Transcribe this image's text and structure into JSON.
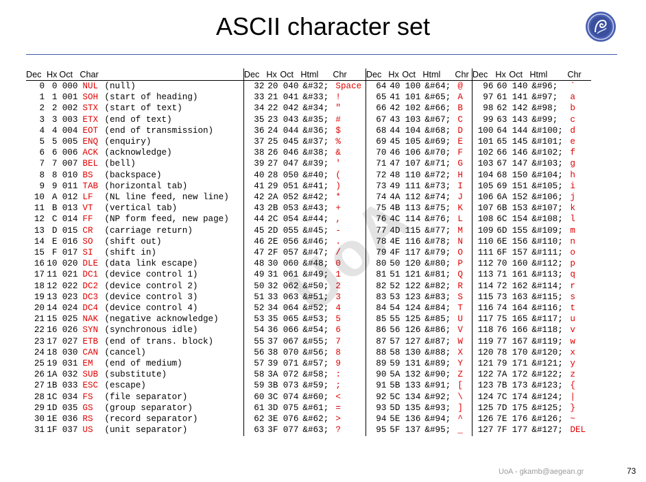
{
  "title": "ASCII character set",
  "watermark": "UoA",
  "footer": "UoA - gkamb@aegean.gr",
  "page_number": "73",
  "colors": {
    "code_red": "#e00000",
    "rule_blue": "#3d55a8"
  },
  "logo_icon": "university-seal-icon",
  "headers": {
    "g1": [
      "Dec",
      "Hx",
      "Oct",
      "Char",
      ""
    ],
    "g2": [
      "Dec",
      "Hx",
      "Oct",
      "Html",
      "Chr"
    ],
    "g3": [
      "Dec",
      "Hx",
      "Oct",
      "Html",
      "Chr"
    ],
    "g4": [
      "Dec",
      "Hx",
      "Oct",
      "Html",
      "Chr"
    ]
  },
  "rows": [
    {
      "g1": [
        "0",
        "0",
        "000",
        "NUL",
        "(null)"
      ],
      "g2": [
        "32",
        "20",
        "040",
        "&#32;",
        "Space"
      ],
      "g3": [
        "64",
        "40",
        "100",
        "&#64;",
        "@"
      ],
      "g4": [
        "96",
        "60",
        "140",
        "&#96;",
        "`"
      ]
    },
    {
      "g1": [
        "1",
        "1",
        "001",
        "SOH",
        "(start of heading)"
      ],
      "g2": [
        "33",
        "21",
        "041",
        "&#33;",
        "!"
      ],
      "g3": [
        "65",
        "41",
        "101",
        "&#65;",
        "A"
      ],
      "g4": [
        "97",
        "61",
        "141",
        "&#97;",
        "a"
      ]
    },
    {
      "g1": [
        "2",
        "2",
        "002",
        "STX",
        "(start of text)"
      ],
      "g2": [
        "34",
        "22",
        "042",
        "&#34;",
        "\""
      ],
      "g3": [
        "66",
        "42",
        "102",
        "&#66;",
        "B"
      ],
      "g4": [
        "98",
        "62",
        "142",
        "&#98;",
        "b"
      ]
    },
    {
      "g1": [
        "3",
        "3",
        "003",
        "ETX",
        "(end of text)"
      ],
      "g2": [
        "35",
        "23",
        "043",
        "&#35;",
        "#"
      ],
      "g3": [
        "67",
        "43",
        "103",
        "&#67;",
        "C"
      ],
      "g4": [
        "99",
        "63",
        "143",
        "&#99;",
        "c"
      ]
    },
    {
      "g1": [
        "4",
        "4",
        "004",
        "EOT",
        "(end of transmission)"
      ],
      "g2": [
        "36",
        "24",
        "044",
        "&#36;",
        "$"
      ],
      "g3": [
        "68",
        "44",
        "104",
        "&#68;",
        "D"
      ],
      "g4": [
        "100",
        "64",
        "144",
        "&#100;",
        "d"
      ]
    },
    {
      "g1": [
        "5",
        "5",
        "005",
        "ENQ",
        "(enquiry)"
      ],
      "g2": [
        "37",
        "25",
        "045",
        "&#37;",
        "%"
      ],
      "g3": [
        "69",
        "45",
        "105",
        "&#69;",
        "E"
      ],
      "g4": [
        "101",
        "65",
        "145",
        "&#101;",
        "e"
      ]
    },
    {
      "g1": [
        "6",
        "6",
        "006",
        "ACK",
        "(acknowledge)"
      ],
      "g2": [
        "38",
        "26",
        "046",
        "&#38;",
        "&"
      ],
      "g3": [
        "70",
        "46",
        "106",
        "&#70;",
        "F"
      ],
      "g4": [
        "102",
        "66",
        "146",
        "&#102;",
        "f"
      ]
    },
    {
      "g1": [
        "7",
        "7",
        "007",
        "BEL",
        "(bell)"
      ],
      "g2": [
        "39",
        "27",
        "047",
        "&#39;",
        "'"
      ],
      "g3": [
        "71",
        "47",
        "107",
        "&#71;",
        "G"
      ],
      "g4": [
        "103",
        "67",
        "147",
        "&#103;",
        "g"
      ]
    },
    {
      "g1": [
        "8",
        "8",
        "010",
        "BS",
        "(backspace)"
      ],
      "g2": [
        "40",
        "28",
        "050",
        "&#40;",
        "("
      ],
      "g3": [
        "72",
        "48",
        "110",
        "&#72;",
        "H"
      ],
      "g4": [
        "104",
        "68",
        "150",
        "&#104;",
        "h"
      ]
    },
    {
      "g1": [
        "9",
        "9",
        "011",
        "TAB",
        "(horizontal tab)"
      ],
      "g2": [
        "41",
        "29",
        "051",
        "&#41;",
        ")"
      ],
      "g3": [
        "73",
        "49",
        "111",
        "&#73;",
        "I"
      ],
      "g4": [
        "105",
        "69",
        "151",
        "&#105;",
        "i"
      ]
    },
    {
      "g1": [
        "10",
        "A",
        "012",
        "LF",
        "(NL line feed, new line)"
      ],
      "g2": [
        "42",
        "2A",
        "052",
        "&#42;",
        "*"
      ],
      "g3": [
        "74",
        "4A",
        "112",
        "&#74;",
        "J"
      ],
      "g4": [
        "106",
        "6A",
        "152",
        "&#106;",
        "j"
      ]
    },
    {
      "g1": [
        "11",
        "B",
        "013",
        "VT",
        "(vertical tab)"
      ],
      "g2": [
        "43",
        "2B",
        "053",
        "&#43;",
        "+"
      ],
      "g3": [
        "75",
        "4B",
        "113",
        "&#75;",
        "K"
      ],
      "g4": [
        "107",
        "6B",
        "153",
        "&#107;",
        "k"
      ]
    },
    {
      "g1": [
        "12",
        "C",
        "014",
        "FF",
        "(NP form feed, new page)"
      ],
      "g2": [
        "44",
        "2C",
        "054",
        "&#44;",
        ","
      ],
      "g3": [
        "76",
        "4C",
        "114",
        "&#76;",
        "L"
      ],
      "g4": [
        "108",
        "6C",
        "154",
        "&#108;",
        "l"
      ]
    },
    {
      "g1": [
        "13",
        "D",
        "015",
        "CR",
        "(carriage return)"
      ],
      "g2": [
        "45",
        "2D",
        "055",
        "&#45;",
        "-"
      ],
      "g3": [
        "77",
        "4D",
        "115",
        "&#77;",
        "M"
      ],
      "g4": [
        "109",
        "6D",
        "155",
        "&#109;",
        "m"
      ]
    },
    {
      "g1": [
        "14",
        "E",
        "016",
        "SO",
        "(shift out)"
      ],
      "g2": [
        "46",
        "2E",
        "056",
        "&#46;",
        "."
      ],
      "g3": [
        "78",
        "4E",
        "116",
        "&#78;",
        "N"
      ],
      "g4": [
        "110",
        "6E",
        "156",
        "&#110;",
        "n"
      ]
    },
    {
      "g1": [
        "15",
        "F",
        "017",
        "SI",
        "(shift in)"
      ],
      "g2": [
        "47",
        "2F",
        "057",
        "&#47;",
        "/"
      ],
      "g3": [
        "79",
        "4F",
        "117",
        "&#79;",
        "O"
      ],
      "g4": [
        "111",
        "6F",
        "157",
        "&#111;",
        "o"
      ]
    },
    {
      "g1": [
        "16",
        "10",
        "020",
        "DLE",
        "(data link escape)"
      ],
      "g2": [
        "48",
        "30",
        "060",
        "&#48;",
        "0"
      ],
      "g3": [
        "80",
        "50",
        "120",
        "&#80;",
        "P"
      ],
      "g4": [
        "112",
        "70",
        "160",
        "&#112;",
        "p"
      ]
    },
    {
      "g1": [
        "17",
        "11",
        "021",
        "DC1",
        "(device control 1)"
      ],
      "g2": [
        "49",
        "31",
        "061",
        "&#49;",
        "1"
      ],
      "g3": [
        "81",
        "51",
        "121",
        "&#81;",
        "Q"
      ],
      "g4": [
        "113",
        "71",
        "161",
        "&#113;",
        "q"
      ]
    },
    {
      "g1": [
        "18",
        "12",
        "022",
        "DC2",
        "(device control 2)"
      ],
      "g2": [
        "50",
        "32",
        "062",
        "&#50;",
        "2"
      ],
      "g3": [
        "82",
        "52",
        "122",
        "&#82;",
        "R"
      ],
      "g4": [
        "114",
        "72",
        "162",
        "&#114;",
        "r"
      ]
    },
    {
      "g1": [
        "19",
        "13",
        "023",
        "DC3",
        "(device control 3)"
      ],
      "g2": [
        "51",
        "33",
        "063",
        "&#51;",
        "3"
      ],
      "g3": [
        "83",
        "53",
        "123",
        "&#83;",
        "S"
      ],
      "g4": [
        "115",
        "73",
        "163",
        "&#115;",
        "s"
      ]
    },
    {
      "g1": [
        "20",
        "14",
        "024",
        "DC4",
        "(device control 4)"
      ],
      "g2": [
        "52",
        "34",
        "064",
        "&#52;",
        "4"
      ],
      "g3": [
        "84",
        "54",
        "124",
        "&#84;",
        "T"
      ],
      "g4": [
        "116",
        "74",
        "164",
        "&#116;",
        "t"
      ]
    },
    {
      "g1": [
        "21",
        "15",
        "025",
        "NAK",
        "(negative acknowledge)"
      ],
      "g2": [
        "53",
        "35",
        "065",
        "&#53;",
        "5"
      ],
      "g3": [
        "85",
        "55",
        "125",
        "&#85;",
        "U"
      ],
      "g4": [
        "117",
        "75",
        "165",
        "&#117;",
        "u"
      ]
    },
    {
      "g1": [
        "22",
        "16",
        "026",
        "SYN",
        "(synchronous idle)"
      ],
      "g2": [
        "54",
        "36",
        "066",
        "&#54;",
        "6"
      ],
      "g3": [
        "86",
        "56",
        "126",
        "&#86;",
        "V"
      ],
      "g4": [
        "118",
        "76",
        "166",
        "&#118;",
        "v"
      ]
    },
    {
      "g1": [
        "23",
        "17",
        "027",
        "ETB",
        "(end of trans. block)"
      ],
      "g2": [
        "55",
        "37",
        "067",
        "&#55;",
        "7"
      ],
      "g3": [
        "87",
        "57",
        "127",
        "&#87;",
        "W"
      ],
      "g4": [
        "119",
        "77",
        "167",
        "&#119;",
        "w"
      ]
    },
    {
      "g1": [
        "24",
        "18",
        "030",
        "CAN",
        "(cancel)"
      ],
      "g2": [
        "56",
        "38",
        "070",
        "&#56;",
        "8"
      ],
      "g3": [
        "88",
        "58",
        "130",
        "&#88;",
        "X"
      ],
      "g4": [
        "120",
        "78",
        "170",
        "&#120;",
        "x"
      ]
    },
    {
      "g1": [
        "25",
        "19",
        "031",
        "EM",
        "(end of medium)"
      ],
      "g2": [
        "57",
        "39",
        "071",
        "&#57;",
        "9"
      ],
      "g3": [
        "89",
        "59",
        "131",
        "&#89;",
        "Y"
      ],
      "g4": [
        "121",
        "79",
        "171",
        "&#121;",
        "y"
      ]
    },
    {
      "g1": [
        "26",
        "1A",
        "032",
        "SUB",
        "(substitute)"
      ],
      "g2": [
        "58",
        "3A",
        "072",
        "&#58;",
        ":"
      ],
      "g3": [
        "90",
        "5A",
        "132",
        "&#90;",
        "Z"
      ],
      "g4": [
        "122",
        "7A",
        "172",
        "&#122;",
        "z"
      ]
    },
    {
      "g1": [
        "27",
        "1B",
        "033",
        "ESC",
        "(escape)"
      ],
      "g2": [
        "59",
        "3B",
        "073",
        "&#59;",
        ";"
      ],
      "g3": [
        "91",
        "5B",
        "133",
        "&#91;",
        "["
      ],
      "g4": [
        "123",
        "7B",
        "173",
        "&#123;",
        "{"
      ]
    },
    {
      "g1": [
        "28",
        "1C",
        "034",
        "FS",
        "(file separator)"
      ],
      "g2": [
        "60",
        "3C",
        "074",
        "&#60;",
        "<"
      ],
      "g3": [
        "92",
        "5C",
        "134",
        "&#92;",
        "\\"
      ],
      "g4": [
        "124",
        "7C",
        "174",
        "&#124;",
        "|"
      ]
    },
    {
      "g1": [
        "29",
        "1D",
        "035",
        "GS",
        "(group separator)"
      ],
      "g2": [
        "61",
        "3D",
        "075",
        "&#61;",
        "="
      ],
      "g3": [
        "93",
        "5D",
        "135",
        "&#93;",
        "]"
      ],
      "g4": [
        "125",
        "7D",
        "175",
        "&#125;",
        "}"
      ]
    },
    {
      "g1": [
        "30",
        "1E",
        "036",
        "RS",
        "(record separator)"
      ],
      "g2": [
        "62",
        "3E",
        "076",
        "&#62;",
        ">"
      ],
      "g3": [
        "94",
        "5E",
        "136",
        "&#94;",
        "^"
      ],
      "g4": [
        "126",
        "7E",
        "176",
        "&#126;",
        "~"
      ]
    },
    {
      "g1": [
        "31",
        "1F",
        "037",
        "US",
        "(unit separator)"
      ],
      "g2": [
        "63",
        "3F",
        "077",
        "&#63;",
        "?"
      ],
      "g3": [
        "95",
        "5F",
        "137",
        "&#95;",
        "_"
      ],
      "g4": [
        "127",
        "7F",
        "177",
        "&#127;",
        "DEL"
      ]
    }
  ]
}
